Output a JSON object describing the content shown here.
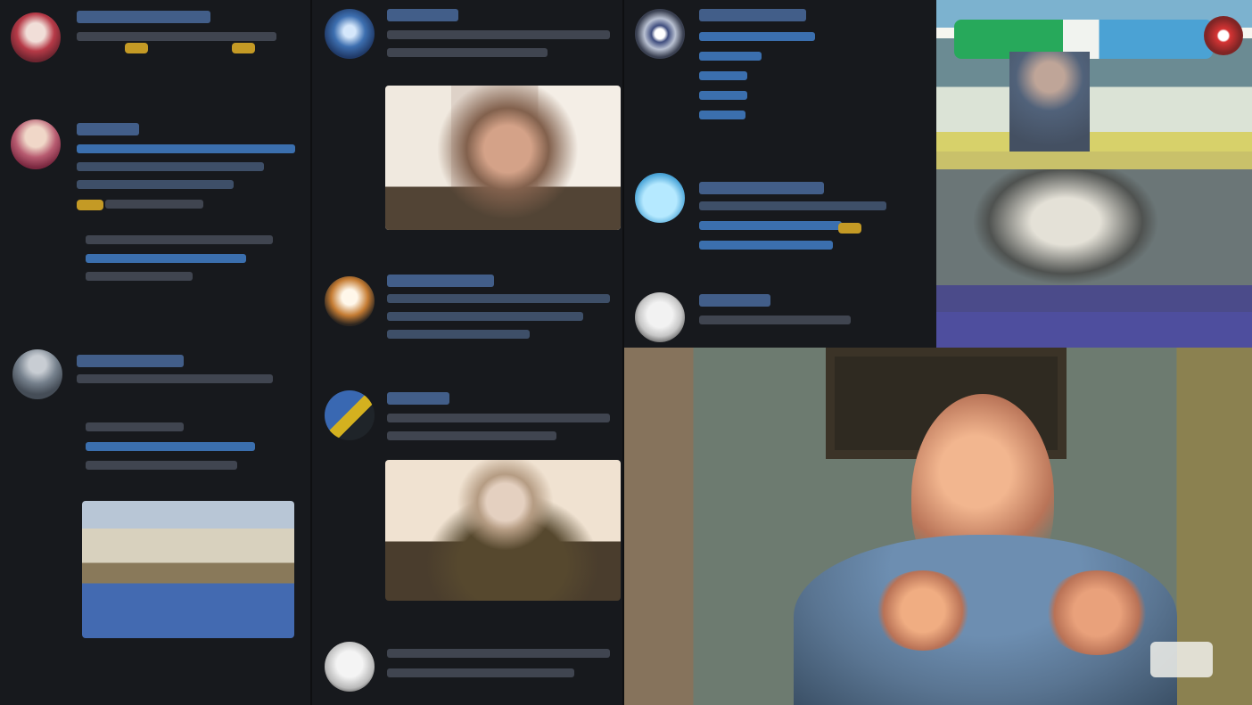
{
  "app": {
    "title": "",
    "status": ""
  },
  "columns": [
    {
      "name": "left-feed",
      "posts": [
        {
          "author": "",
          "handle": "",
          "text": ""
        },
        {
          "author": "",
          "handle": "",
          "text": ""
        },
        {
          "author": "",
          "handle": "",
          "text": ""
        }
      ]
    },
    {
      "name": "middle-feed",
      "posts": [
        {
          "author": "",
          "handle": "",
          "text": ""
        },
        {
          "author": "",
          "handle": "",
          "text": ""
        },
        {
          "author": "",
          "handle": "",
          "text": ""
        },
        {
          "author": "",
          "handle": "",
          "text": ""
        }
      ]
    },
    {
      "name": "right-feed",
      "posts": [
        {
          "author": "",
          "handle": "",
          "text": ""
        },
        {
          "author": "",
          "handle": "",
          "text": ""
        },
        {
          "author": "",
          "handle": "",
          "text": ""
        }
      ]
    }
  ],
  "colors": {
    "background": "#15181c",
    "column": "#17191d",
    "link": "#44628f",
    "muted": "#404550",
    "accent": "#c49a25"
  }
}
